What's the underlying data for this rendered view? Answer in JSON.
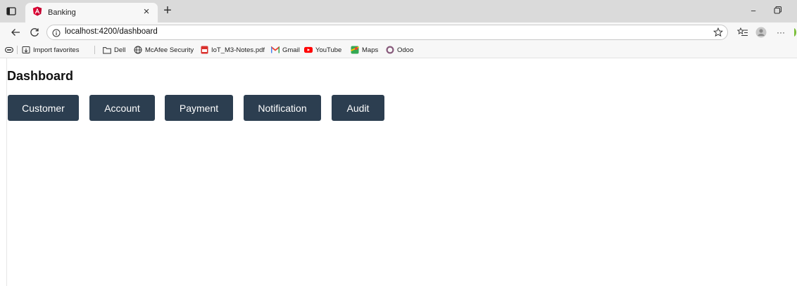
{
  "browser": {
    "tab": {
      "title": "Banking",
      "close": "×",
      "new_tab": "+"
    },
    "window_controls": {
      "minimize": "−",
      "restore": "▢"
    },
    "address": {
      "url": "localhost:4200/dashboard"
    },
    "toolbar": {
      "more": "···"
    },
    "favorites": {
      "import": "Import favorites",
      "items": [
        {
          "label": "Dell",
          "icon": "folder-icon"
        },
        {
          "label": "McAfee Security",
          "icon": "globe-icon"
        },
        {
          "label": "IoT_M3-Notes.pdf",
          "icon": "pdf-icon"
        },
        {
          "label": "Gmail",
          "icon": "gmail-icon"
        },
        {
          "label": "YouTube",
          "icon": "youtube-icon"
        },
        {
          "label": "Maps",
          "icon": "maps-icon"
        },
        {
          "label": "Odoo",
          "icon": "odoo-icon"
        }
      ]
    }
  },
  "page": {
    "title": "Dashboard",
    "buttons": [
      "Customer",
      "Account",
      "Payment",
      "Notification",
      "Audit"
    ],
    "button_color": "#2c3e50"
  }
}
